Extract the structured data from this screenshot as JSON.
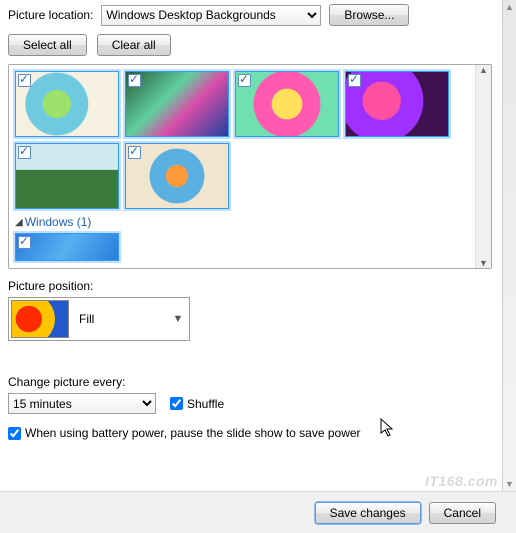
{
  "labels": {
    "picture_location": "Picture location:",
    "picture_position": "Picture position:",
    "change_every": "Change picture every:"
  },
  "location_select": "Windows Desktop Backgrounds",
  "buttons": {
    "browse": "Browse...",
    "select_all": "Select all",
    "clear_all": "Clear all",
    "save": "Save changes",
    "cancel": "Cancel"
  },
  "section": {
    "windows": "Windows (1)"
  },
  "position": {
    "value": "Fill"
  },
  "interval": {
    "value": "15 minutes"
  },
  "shuffle": {
    "label": "Shuffle",
    "checked": true
  },
  "battery": {
    "label": "When using battery power, pause the slide show to save power",
    "checked": true
  },
  "thumbs": [
    {
      "checked": true
    },
    {
      "checked": true
    },
    {
      "checked": true
    },
    {
      "checked": true
    },
    {
      "checked": true
    },
    {
      "checked": true
    }
  ],
  "windows_thumb": {
    "checked": true
  }
}
